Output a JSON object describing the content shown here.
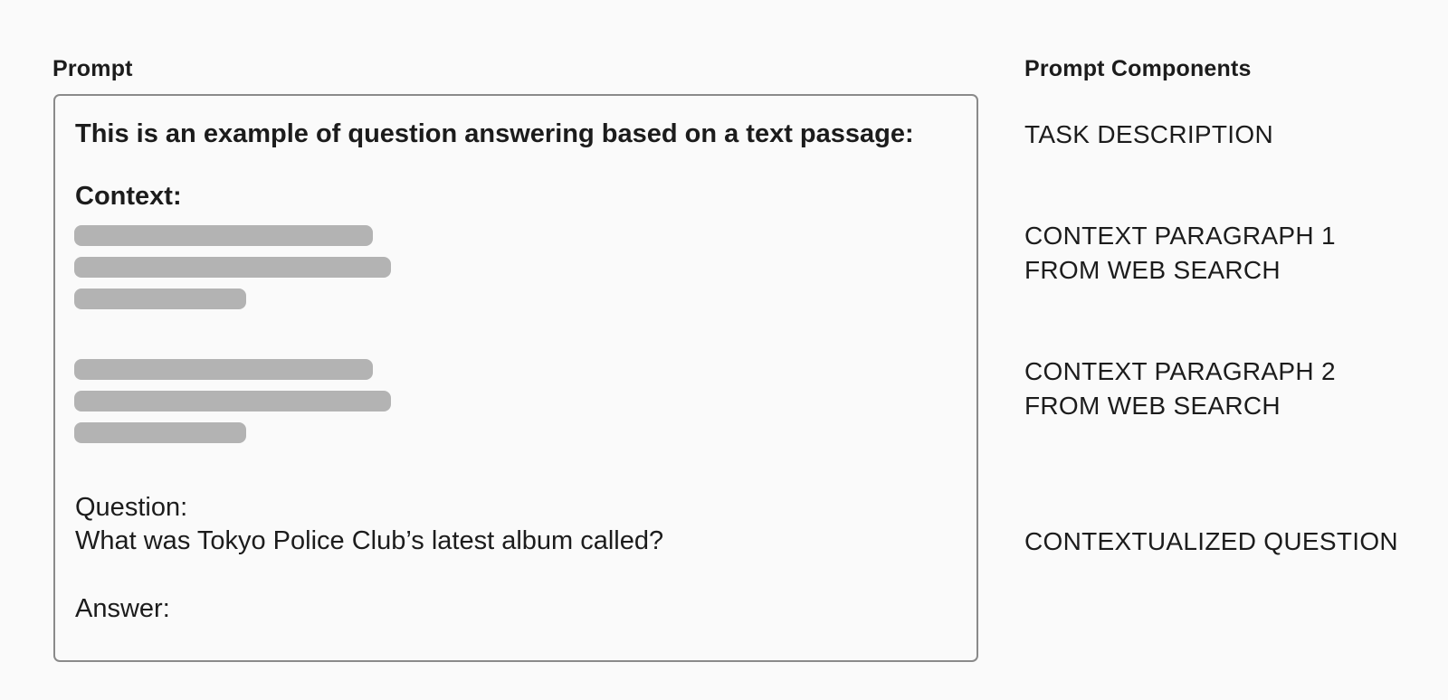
{
  "headings": {
    "prompt": "Prompt",
    "components": "Prompt Components"
  },
  "prompt": {
    "task_description": "This is an example of question answering based on a text passage:",
    "context_label": "Context:",
    "question_label": "Question:",
    "question_text": "What was Tokyo Police Club’s latest album called?",
    "answer_label": "Answer:"
  },
  "components": {
    "task": "TASK DESCRIPTION",
    "context_1": "CONTEXT PARAGRAPH 1\nFROM WEB SEARCH",
    "context_2": "CONTEXT PARAGRAPH 2\nFROM WEB SEARCH",
    "question": "CONTEXTUALIZED QUESTION"
  },
  "colors": {
    "placeholder_bar": "#b3b3b3",
    "box_border": "#8a8a8a",
    "background": "#fafafa",
    "text": "#1c1c1c"
  }
}
